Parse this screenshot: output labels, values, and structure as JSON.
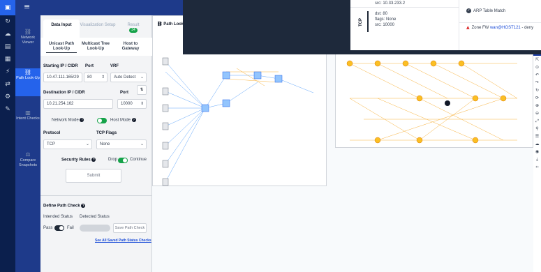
{
  "nav": {
    "items": [
      {
        "label": "Network Viewer"
      },
      {
        "label": "Path Look-Up"
      },
      {
        "label": "Intent Checks"
      },
      {
        "label": "Compare Snapshots"
      }
    ]
  },
  "tabs": [
    {
      "label": "Data Input"
    },
    {
      "label": "Visualization Setup"
    },
    {
      "label": "Result",
      "badge": "34"
    }
  ],
  "subtabs": [
    {
      "label": "Unicast Path Look-Up"
    },
    {
      "label": "Multicast Tree Look-Up"
    },
    {
      "label": "Host to Gateway"
    }
  ],
  "form": {
    "starting_ip_label": "Starting IP / CIDR",
    "starting_ip_value": "10.47.111.165/29",
    "port_label": "Port",
    "port_value": "80",
    "vrf_label": "VRF",
    "vrf_value": "Auto Detect",
    "dest_ip_label": "Destination IP / CIDR",
    "dest_ip_value": "10.21.254.162",
    "dest_port_label": "Port",
    "dest_port_value": "10000",
    "network_mode_label": "Network Mode",
    "host_mode_label": "Host Mode",
    "protocol_label": "Protocol",
    "protocol_value": "TCP",
    "tcp_flags_label": "TCP Flags",
    "tcp_flags_value": "None",
    "security_rules_label": "Security Rules",
    "drop_label": "Drop",
    "continue_label": "Continue",
    "submit_label": "Submit"
  },
  "path_check": {
    "title": "Define Path Check",
    "intended_label": "Intended Status",
    "detected_label": "Detected Status",
    "pass_label": "Pass",
    "fail_label": "Fail",
    "save_label": "Save Path Check",
    "see_all_label": "See All Saved Path Status Checks"
  },
  "graph": {
    "title": "Path Look-U"
  },
  "popup": {
    "src_top": "src: 10.33.233.2",
    "protocol": "TCP",
    "tcp_lines": [
      "dst: 80",
      "flags: None",
      "src: 10000"
    ],
    "arp_label": "ARP Table Match",
    "fw_prefix": "Zone FW ",
    "fw_host": "wan@HOST121",
    "fw_suffix": " - deny"
  },
  "colors": {
    "accent": "#2563eb",
    "toggle_on": "#16a34a",
    "toggle_off": "#1f2937",
    "badge": "#16a34a",
    "edge": "#f59e0b",
    "node": "#3b82f6"
  }
}
